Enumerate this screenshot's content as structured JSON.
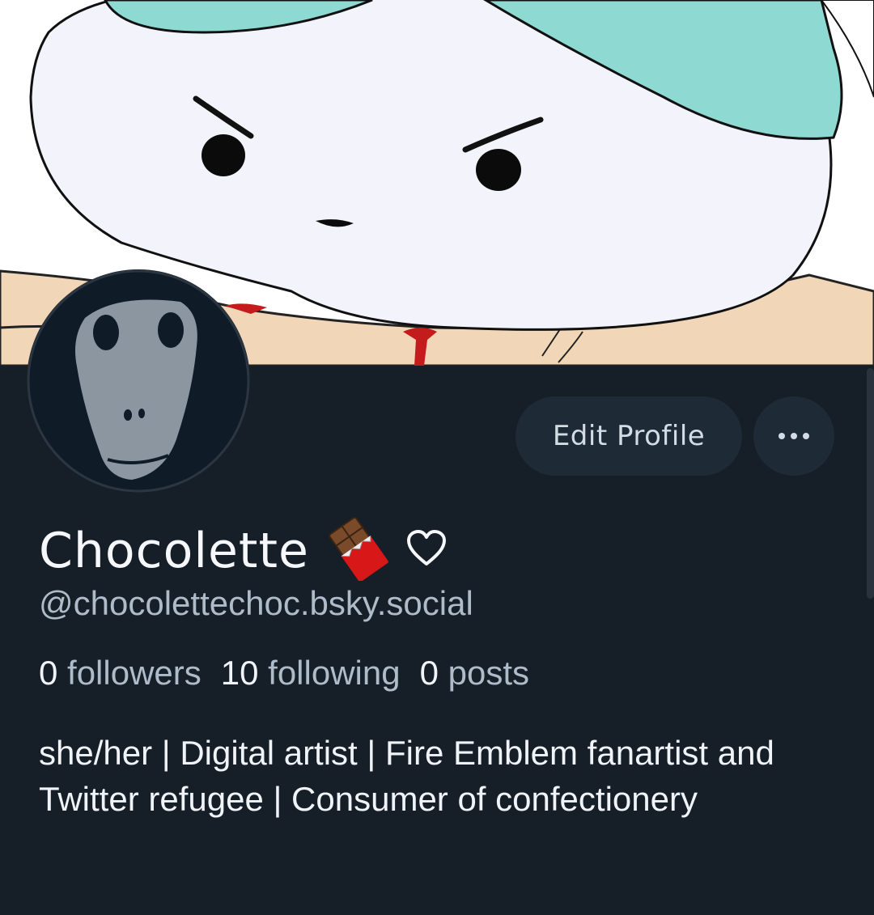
{
  "profile": {
    "display_name": "Chocolette",
    "name_emoji_icon": "chocolate-bar-icon",
    "name_heart_icon": "heart-outline-icon",
    "handle": "@chocolettechoc.bsky.social",
    "stats": {
      "followers_count": "0",
      "followers_label": "followers",
      "following_count": "10",
      "following_label": "following",
      "posts_count": "0",
      "posts_label": "posts"
    },
    "bio": "she/her | Digital artist | Fire Emblem fanartist and Twitter refugee | Consumer of confectionery"
  },
  "actions": {
    "edit_profile_label": "Edit Profile",
    "more_icon": "ellipsis-icon"
  },
  "colors": {
    "background": "#161e27",
    "button_bg": "#1f2a37",
    "text_primary": "#f0f3f7",
    "text_secondary": "#aebbc9"
  }
}
